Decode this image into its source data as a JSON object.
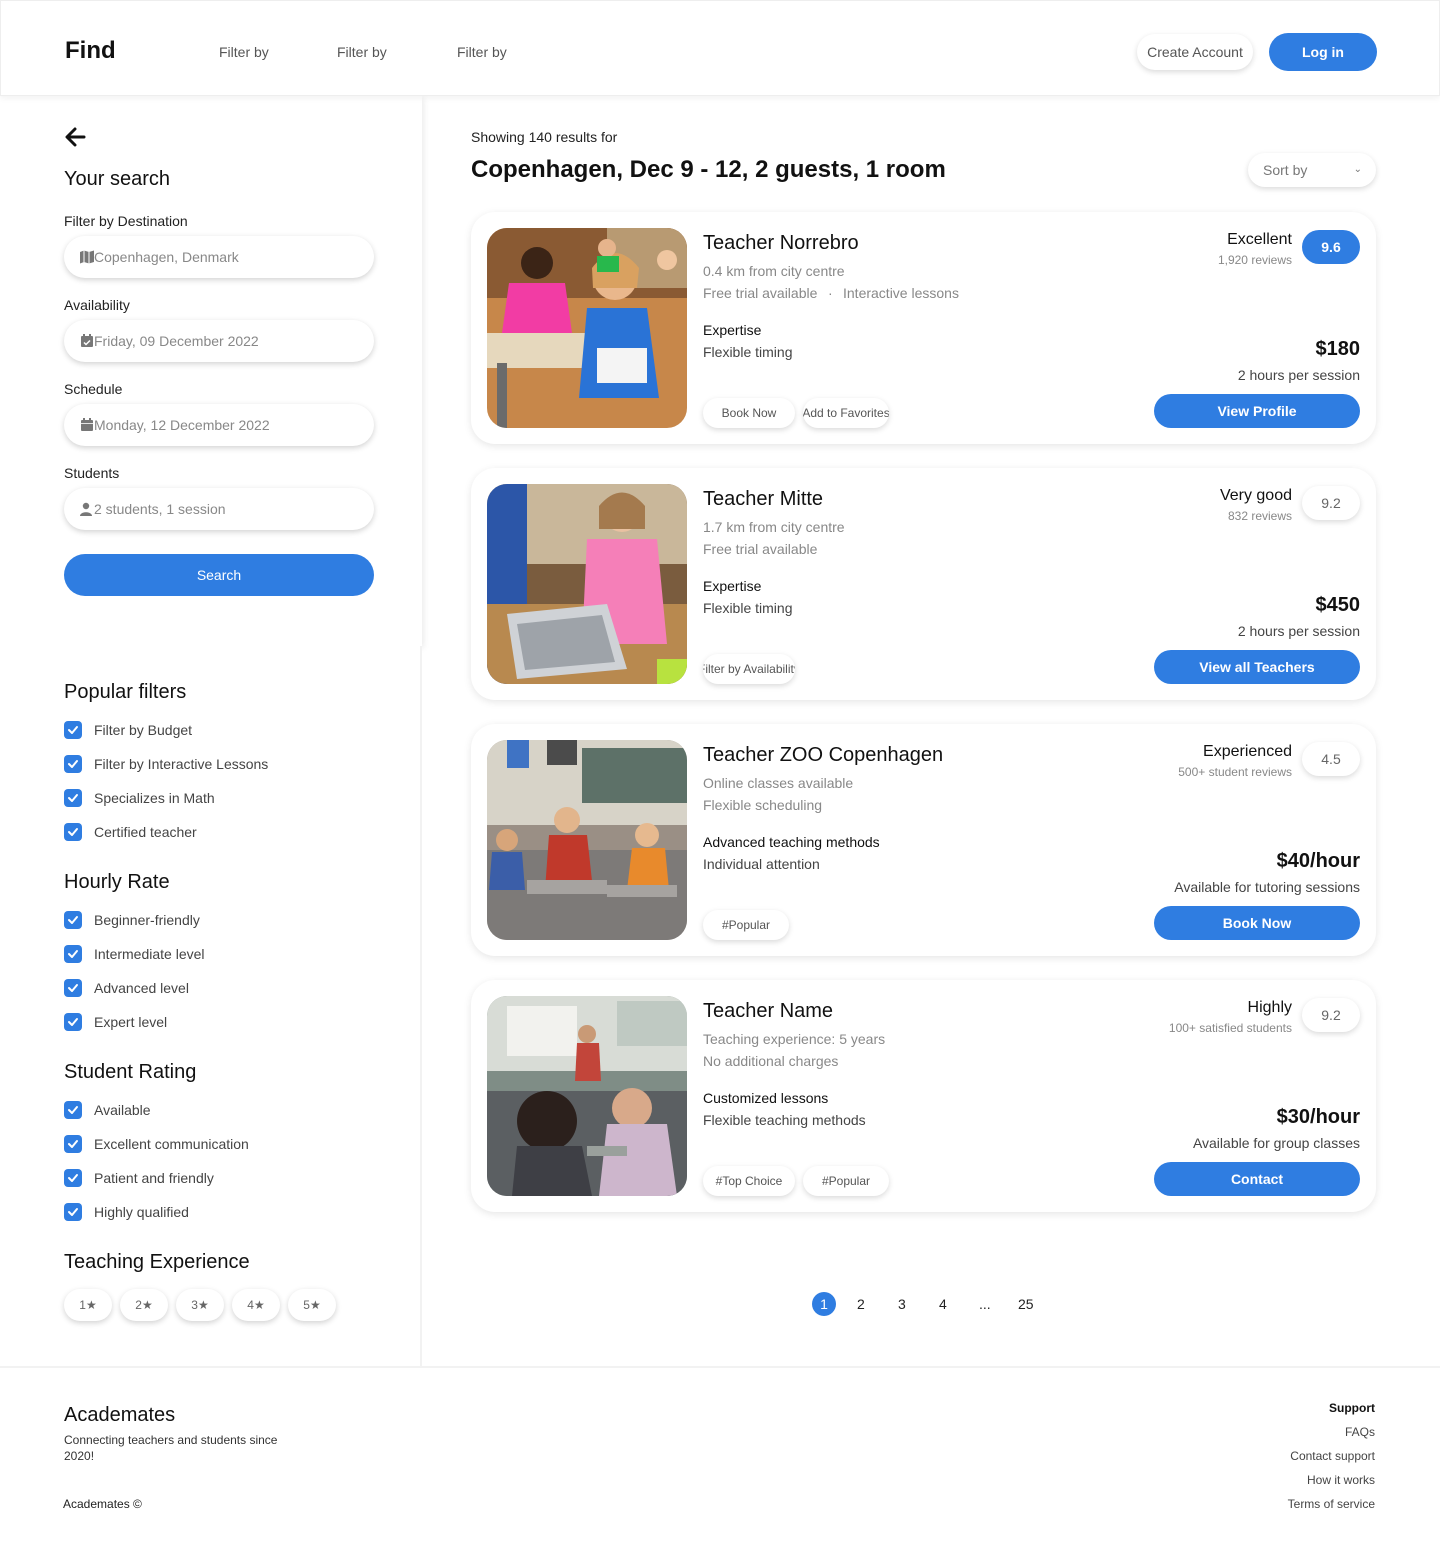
{
  "header": {
    "brand": "Find",
    "nav": [
      "Filter by",
      "Filter by",
      "Filter by"
    ],
    "create_account": "Create Account",
    "login": "Log in"
  },
  "sidebar": {
    "title": "Your search",
    "destination": {
      "label": "Filter by Destination",
      "value": "Copenhagen, Denmark"
    },
    "availability": {
      "label": "Availability",
      "value": "Friday, 09 December 2022"
    },
    "schedule": {
      "label": "Schedule",
      "value": "Monday, 12 December 2022"
    },
    "students": {
      "label": "Students",
      "value": "2 students, 1 session"
    },
    "search_button": "Search",
    "popular_filters": {
      "title": "Popular filters",
      "items": [
        "Filter by Budget",
        "Filter by Interactive Lessons",
        "Specializes in Math",
        "Certified teacher"
      ]
    },
    "hourly_rate": {
      "title": "Hourly Rate",
      "items": [
        "Beginner-friendly",
        "Intermediate level",
        "Advanced level",
        "Expert level"
      ]
    },
    "student_rating": {
      "title": "Student Rating",
      "items": [
        "Available",
        "Excellent communication",
        "Patient and friendly",
        "Highly qualified"
      ]
    },
    "teaching_experience": {
      "title": "Teaching Experience",
      "stars": [
        "1★",
        "2★",
        "3★",
        "4★",
        "5★"
      ]
    }
  },
  "results": {
    "showing": "Showing 140 results for",
    "query": "Copenhagen, Dec 9 - 12, 2 guests, 1 room",
    "sort_label": "Sort by",
    "cards": [
      {
        "name": "Teacher Norrebro",
        "line1": "0.4 km from city centre",
        "line2a": "Free trial available",
        "line2b": "Interactive lessons",
        "feature_title": "Expertise",
        "feature_text": "Flexible timing",
        "rating_label": "Excellent",
        "rating_sub": "1,920 reviews",
        "score": "9.6",
        "price": "$180",
        "price_sub": "2 hours per session",
        "tags": [
          "Book Now",
          "Add to Favorites"
        ],
        "cta": "View Profile"
      },
      {
        "name": "Teacher Mitte",
        "line1": "1.7 km from city centre",
        "line2a": "Free trial available",
        "feature_title": "Expertise",
        "feature_text": "Flexible timing",
        "rating_label": "Very good",
        "rating_sub": "832 reviews",
        "score": "9.2",
        "price": "$450",
        "price_sub": "2 hours per session",
        "tags": [
          "Filter by Availability"
        ],
        "cta": "View all Teachers"
      },
      {
        "name": "Teacher ZOO Copenhagen",
        "line1": "Online classes available",
        "line2a": "Flexible scheduling",
        "feature_title": "Advanced teaching methods",
        "feature_text": "Individual attention",
        "rating_label": "Experienced",
        "rating_sub": "500+ student reviews",
        "score": "4.5",
        "price": "$40/hour",
        "price_sub": "Available for tutoring sessions",
        "tags": [
          "#Popular"
        ],
        "cta": "Book Now"
      },
      {
        "name": "Teacher Name",
        "line1": "Teaching experience: 5 years",
        "line2a": "No additional charges",
        "feature_title": "Customized lessons",
        "feature_text": "Flexible teaching methods",
        "rating_label": "Highly",
        "rating_sub": "100+ satisfied students",
        "score": "9.2",
        "price": "$30/hour",
        "price_sub": "Available for group classes",
        "tags": [
          "#Top Choice",
          "#Popular"
        ],
        "cta": "Contact"
      }
    ]
  },
  "pagination": {
    "current": "1",
    "pages": [
      "2",
      "3",
      "4",
      "...",
      "25"
    ]
  },
  "footer": {
    "brand": "Academates",
    "tagline": "Connecting teachers and students since 2020!",
    "copyright": "Academates ©",
    "support_title": "Support",
    "links": [
      "FAQs",
      "Contact support",
      "How it works",
      "Terms of service"
    ]
  },
  "colors": {
    "accent": "#2f7de1",
    "text": "#111111",
    "muted": "#888888"
  },
  "icons": [
    "back-arrow-icon",
    "map-icon",
    "calendar-check-icon",
    "calendar-icon",
    "user-icon",
    "check-icon",
    "star-icon",
    "chevron-down-icon"
  ]
}
